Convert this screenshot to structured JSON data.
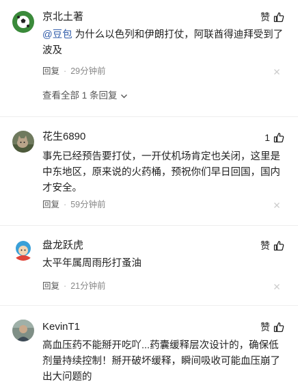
{
  "comments": [
    {
      "username": "京北土著",
      "like_label": "赞",
      "mention": "@豆包",
      "text": " 为什么以色列和伊朗打仗，阿联酋得迪拜受到了波及",
      "reply_label": "回复",
      "separator": "·",
      "time": "29分钟前",
      "expand_label": "查看全部 1 条回复",
      "avatar_icon": "soccer-ball-avatar"
    },
    {
      "username": "花生6890",
      "like_label": "1",
      "text": "事先已经预告要打仗，一开仗机场肯定也关闭，这里是中东地区，原来说的火药桶，预祝你们早日回国，国内才安全。",
      "reply_label": "回复",
      "separator": "·",
      "time": "59分钟前",
      "avatar_icon": "cat-photo-avatar"
    },
    {
      "username": "盘龙跃虎",
      "like_label": "赞",
      "text": "太平年属周雨彤打蚤油",
      "reply_label": "回复",
      "separator": "·",
      "time": "21分钟前",
      "avatar_icon": "cartoon-character-avatar"
    },
    {
      "username": "KevinT1",
      "like_label": "赞",
      "text": "高血压药不能掰开吃吖...药囊缓释层次设计的，确保低剂量持续控制！掰开破坏缓释，瞬间吸收可能血压崩了出大问题的",
      "avatar_icon": "person-photo-avatar"
    }
  ],
  "colors": {
    "mention": "#2e5aa8",
    "meta": "#888888",
    "divider": "#eeeeee"
  }
}
